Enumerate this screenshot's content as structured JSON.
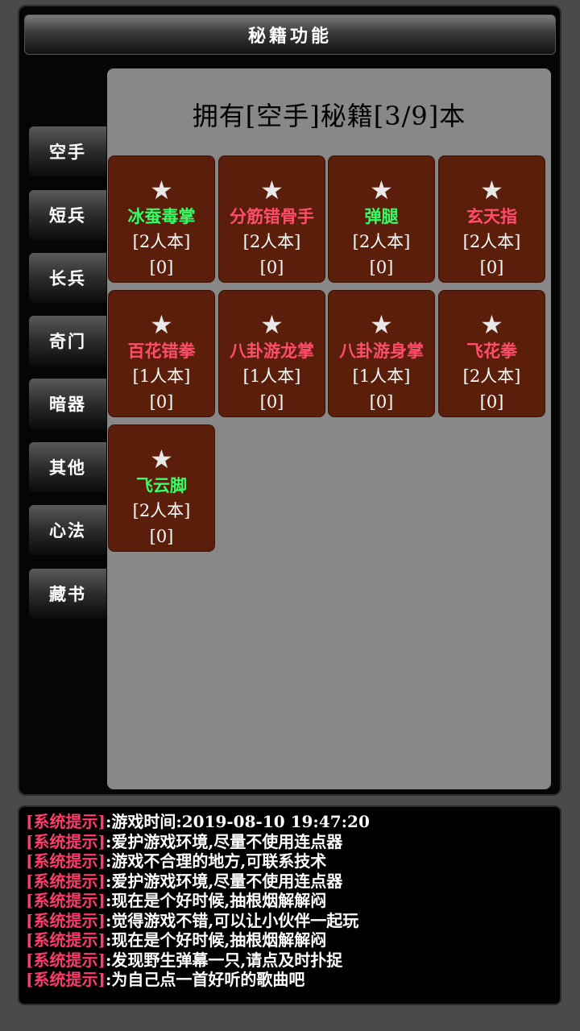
{
  "title": "秘籍功能",
  "sidebar": {
    "items": [
      {
        "label": "空手"
      },
      {
        "label": "短兵"
      },
      {
        "label": "长兵"
      },
      {
        "label": "奇门"
      },
      {
        "label": "暗器"
      },
      {
        "label": "其他"
      },
      {
        "label": "心法"
      },
      {
        "label": "藏书"
      }
    ]
  },
  "panel": {
    "owned_text": "拥有[空手]秘籍[3/9]本",
    "cards": [
      {
        "star": "★",
        "name": "冰蚕毒掌",
        "name_color": "#33ff66",
        "edition": "[2人本]",
        "count": "[0]"
      },
      {
        "star": "★",
        "name": "分筋错骨手",
        "name_color": "#ff4d6d",
        "edition": "[2人本]",
        "count": "[0]"
      },
      {
        "star": "★",
        "name": "弹腿",
        "name_color": "#33ff66",
        "edition": "[2人本]",
        "count": "[0]"
      },
      {
        "star": "★",
        "name": "玄天指",
        "name_color": "#ff4d6d",
        "edition": "[2人本]",
        "count": "[0]"
      },
      {
        "star": "★",
        "name": "百花错拳",
        "name_color": "#ff4d6d",
        "edition": "[1人本]",
        "count": "[0]"
      },
      {
        "star": "★",
        "name": "八卦游龙掌",
        "name_color": "#ff4d6d",
        "edition": "[1人本]",
        "count": "[0]"
      },
      {
        "star": "★",
        "name": "八卦游身掌",
        "name_color": "#ff4d6d",
        "edition": "[1人本]",
        "count": "[0]"
      },
      {
        "star": "★",
        "name": "飞花拳",
        "name_color": "#ff4d6d",
        "edition": "[2人本]",
        "count": "[0]"
      },
      {
        "star": "★",
        "name": "飞云脚",
        "name_color": "#33ff66",
        "edition": "[2人本]",
        "count": "[0]"
      }
    ]
  },
  "log": {
    "tag": "[系统提示]",
    "lines": [
      ":游戏时间:2019-08-10 19:47:20",
      ":爱护游戏环境,尽量不使用连点器",
      ":游戏不合理的地方,可联系技术",
      ":爱护游戏环境,尽量不使用连点器",
      ":现在是个好时候,抽根烟解解闷",
      ":觉得游戏不错,可以让小伙伴一起玩",
      ":现在是个好时候,抽根烟解解闷",
      ":发现野生弹幕一只,请点及时扑捉",
      ":为自己点一首好听的歌曲吧"
    ]
  },
  "colors": {
    "card_bg": "#5b1e0a",
    "panel_bg": "#888888",
    "tag_color": "#ff3b6a",
    "green_name": "#33ff66",
    "red_name": "#ff4d6d"
  }
}
